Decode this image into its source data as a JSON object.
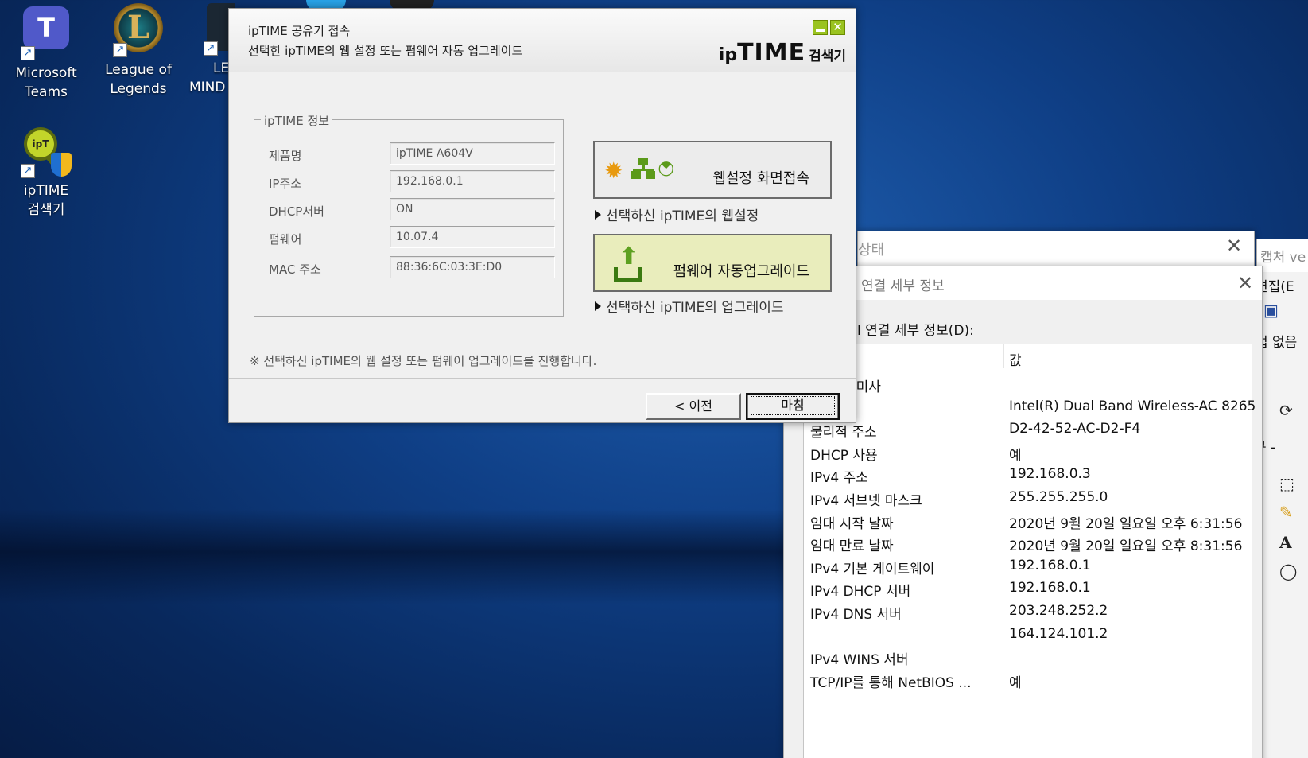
{
  "desktop": {
    "icons": [
      {
        "line1": "Microsoft",
        "line2": "Teams",
        "glyph": "T"
      },
      {
        "line1": "League of",
        "line2": "Legends",
        "glyph": "L"
      },
      {
        "line1": "LE",
        "line2": "MIND"
      },
      {
        "line1": "ipTIME",
        "line2": "검색기",
        "glyph": "ipT"
      }
    ],
    "shortcut_glyph": "↗"
  },
  "iptime_dialog": {
    "title": "ipTIME 공유기 접속",
    "subtitle": "선택한 ipTIME의 웹 설정 또는 펌웨어 자동 업그레이드",
    "logo_ip": "ip",
    "logo_time": "TIME",
    "logo_search": "검색기",
    "close_glyph": "✕",
    "group_title": "ipTIME 정보",
    "info": [
      {
        "label": "제품명",
        "value": "ipTIME A604V"
      },
      {
        "label": "IP주소",
        "value": "192.168.0.1"
      },
      {
        "label": "DHCP서버",
        "value": "ON"
      },
      {
        "label": "펌웨어",
        "value": "10.07.4"
      },
      {
        "label": "MAC 주소",
        "value": "88:36:6C:03:3E:D0"
      }
    ],
    "web_button_label": "웹설정  화면접속",
    "web_desc": "선택하신 ipTIME의 웹설정",
    "fw_button_label": "펌웨어  자동업그레이드",
    "fw_desc": "선택하신 ipTIME의 업그레이드",
    "note": "※ 선택하신 ipTIME의 웹 설정 또는 펌웨어 업그레이드를 진행합니다.",
    "prev_button": "< 이전",
    "close_button": "마침"
  },
  "status_window": {
    "title": "상태",
    "close_glyph": "✕"
  },
  "detail_window": {
    "title": "연결 세부 정보",
    "close_glyph": "✕",
    "heading": "l 연결 세부 정보(D):",
    "column_value": "값",
    "rows": [
      {
        "prop": "DNS 접미사",
        "val": ""
      },
      {
        "prop": "",
        "val": "Intel(R) Dual Band Wireless-AC 8265"
      },
      {
        "prop": "물리적 주소",
        "val": "D2-42-52-AC-D2-F4"
      },
      {
        "prop": "DHCP 사용",
        "val": "예"
      },
      {
        "prop": "IPv4 주소",
        "val": "192.168.0.3"
      },
      {
        "prop": "IPv4 서브넷 마스크",
        "val": "255.255.255.0"
      },
      {
        "prop": "임대 시작 날짜",
        "val": "2020년 9월 20일 일요일 오후 6:31:56"
      },
      {
        "prop": "임대 만료 날짜",
        "val": "2020년 9월 20일 일요일 오후 8:31:56"
      },
      {
        "prop": "IPv4 기본 게이트웨이",
        "val": "192.168.0.1"
      },
      {
        "prop": "IPv4 DHCP 서버",
        "val": "192.168.0.1"
      },
      {
        "prop": "IPv4 DNS 서버",
        "val": "203.248.252.2"
      },
      {
        "prop": "",
        "val": "164.124.101.2"
      },
      {
        "prop": "IPv4 WINS 서버",
        "val": ""
      },
      {
        "prop": "TCP/IP를 통해 NetBIOS ...",
        "val": "예"
      }
    ]
  },
  "snip_window": {
    "title": "캡처 ve",
    "menu_edit": "편집(E",
    "no_delay": "업 없음",
    "tool_label": "구 -",
    "icons": [
      "save-icon",
      "refresh-icon",
      "rect-select-icon",
      "pen-icon",
      "text-icon",
      "circle-icon"
    ]
  }
}
